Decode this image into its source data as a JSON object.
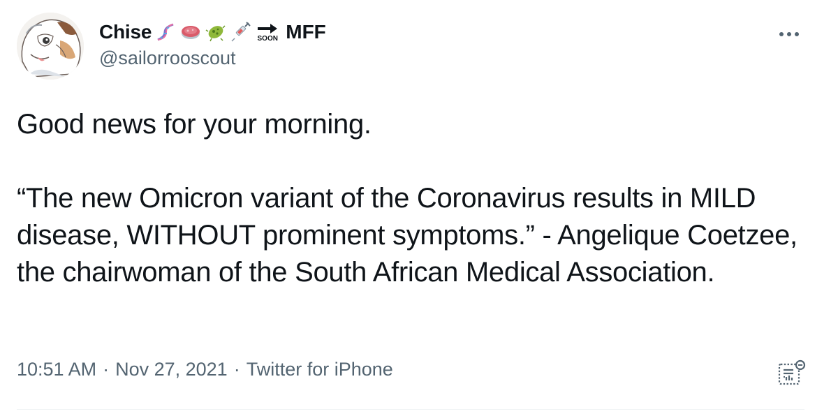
{
  "tweet": {
    "display_name": "Chise",
    "name_suffix": "MFF",
    "soon_label": "SOON",
    "handle": "@sailorrooscout",
    "name_emojis": [
      "dna-emoji",
      "petri-dish-emoji",
      "microbe-emoji",
      "syringe-emoji",
      "soon-arrow-emoji"
    ],
    "body_line_1": "Good news for your morning.",
    "body_line_2": "“The new Omicron variant of the Coronavirus results in MILD disease, WITHOUT prominent symptoms.” - Angelique Coetzee, the chairwoman of the South African Medical Association.",
    "time": "10:51 AM",
    "date": "Nov 27, 2021",
    "source": "Twitter for iPhone",
    "separator": "·"
  },
  "colors": {
    "text_primary": "#0f1419",
    "text_secondary": "#536471",
    "divider": "#eff3f4"
  }
}
